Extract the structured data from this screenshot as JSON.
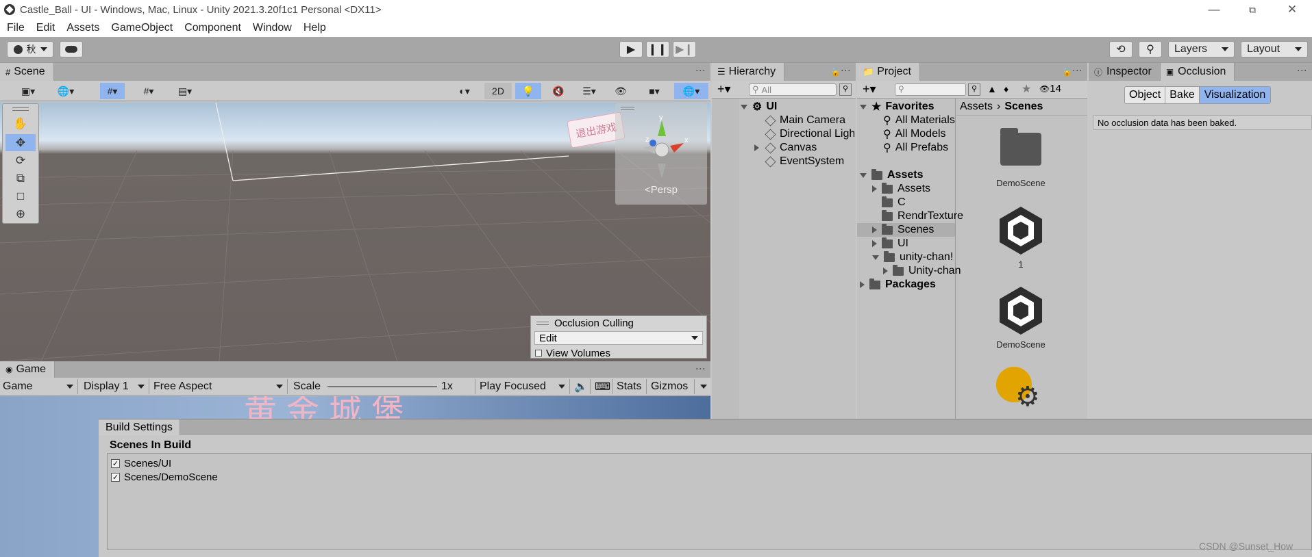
{
  "window": {
    "title": "Castle_Ball - UI - Windows, Mac, Linux - Unity 2021.3.20f1c1 Personal <DX11>",
    "minimize": "—",
    "maximize": "⧉",
    "close": "✕"
  },
  "menu": [
    "File",
    "Edit",
    "Assets",
    "GameObject",
    "Component",
    "Window",
    "Help"
  ],
  "toolbar": {
    "account": "秋",
    "layers": "Layers",
    "layout": "Layout"
  },
  "scene": {
    "tab": "Scene",
    "btn_2d": "2D",
    "persp": "<Persp",
    "occlusion_title": "Occlusion Culling",
    "occlusion_mode": "Edit",
    "view_volumes": "View Volumes",
    "sign_text": "退出游戏"
  },
  "game": {
    "tab": "Game",
    "mode": "Game",
    "display": "Display 1",
    "aspect": "Free Aspect",
    "scale_label": "Scale",
    "scale_value": "1x",
    "play_focused": "Play Focused",
    "stats": "Stats",
    "gizmos": "Gizmos",
    "banner_text": "黄金城堡"
  },
  "hierarchy": {
    "tab": "Hierarchy",
    "search_placeholder": "All",
    "root": "UI",
    "items": [
      "Main Camera",
      "Directional Light",
      "Canvas",
      "EventSystem"
    ]
  },
  "project": {
    "tab": "Project",
    "count": "14",
    "favorites": "Favorites",
    "fav_items": [
      "All Materials",
      "All Models",
      "All Prefabs"
    ],
    "assets": "Assets",
    "asset_folders": [
      "Assets",
      "C",
      "RendrTexture",
      "Scenes",
      "UI",
      "unity-chan!",
      "Unity-chan"
    ],
    "packages": "Packages",
    "breadcrumb": [
      "Assets",
      "Scenes"
    ],
    "grid": [
      "DemoScene",
      "1",
      "DemoScene"
    ]
  },
  "inspector": {
    "tab_inspector": "Inspector",
    "tab_occlusion": "Occlusion",
    "buttons": [
      "Object",
      "Bake",
      "Visualization"
    ],
    "message": "No occlusion data has been baked."
  },
  "build": {
    "tab": "Build Settings",
    "heading": "Scenes In Build",
    "scenes": [
      "Scenes/UI",
      "Scenes/DemoScene"
    ]
  },
  "watermark": "CSDN @Sunset_How"
}
